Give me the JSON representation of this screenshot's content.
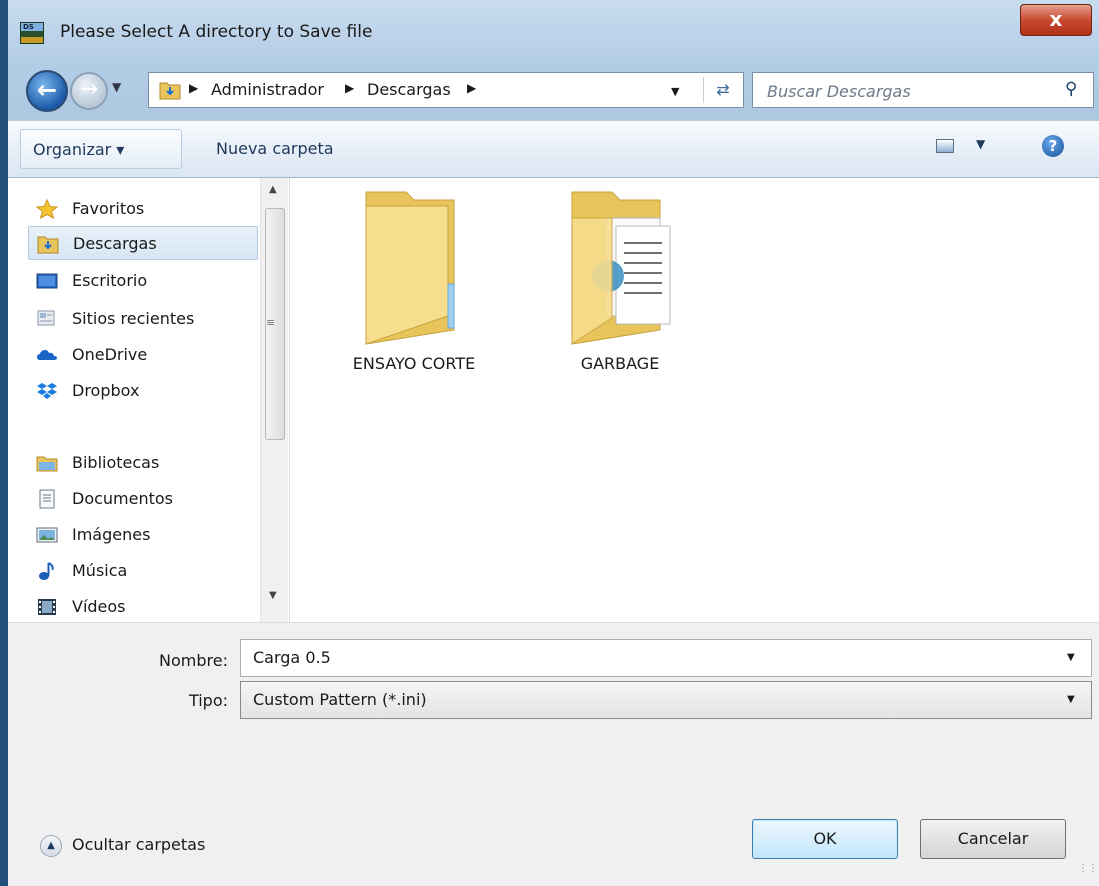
{
  "window": {
    "title": "Please Select A directory to Save file",
    "close_label": "x"
  },
  "app_icon_text": "DS",
  "navigation": {
    "breadcrumbs": [
      "Administrador",
      "Descargas"
    ],
    "search_placeholder": "Buscar Descargas"
  },
  "toolbar": {
    "organizar_label": "Organizar ▾",
    "nueva_carpeta_label": "Nueva carpeta",
    "help_label": "?"
  },
  "sidebar": {
    "items": [
      {
        "label": "Favoritos",
        "icon": "star-icon"
      },
      {
        "label": "Descargas",
        "icon": "downloads-folder-icon",
        "selected": true
      },
      {
        "label": "Escritorio",
        "icon": "desktop-icon"
      },
      {
        "label": "Sitios recientes",
        "icon": "recent-places-icon"
      },
      {
        "label": "OneDrive",
        "icon": "onedrive-icon"
      },
      {
        "label": "Dropbox",
        "icon": "dropbox-icon"
      },
      {
        "label": "Bibliotecas",
        "icon": "libraries-icon"
      },
      {
        "label": "Documentos",
        "icon": "documents-icon"
      },
      {
        "label": "Imágenes",
        "icon": "images-icon"
      },
      {
        "label": "Música",
        "icon": "music-icon"
      },
      {
        "label": "Vídeos",
        "icon": "videos-icon"
      }
    ]
  },
  "files": [
    {
      "name": "ENSAYO CORTE",
      "icon": "folder-icon"
    },
    {
      "name": "GARBAGE",
      "icon": "folder-with-documents-icon"
    }
  ],
  "form": {
    "nombre_label": "Nombre:",
    "nombre_value": "Carga 0.5",
    "tipo_label": "Tipo:",
    "tipo_value": "Custom Pattern (*.ini)"
  },
  "footer": {
    "hide_folders_label": "Ocultar carpetas",
    "ok_label": "OK",
    "cancel_label": "Cancelar"
  }
}
